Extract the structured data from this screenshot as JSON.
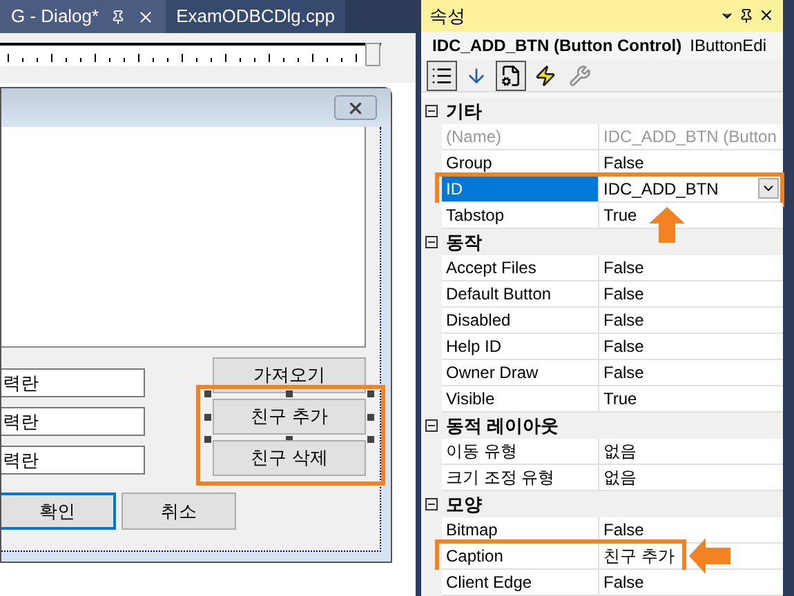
{
  "tabs": [
    {
      "label": "G - Dialog*",
      "selected": true
    },
    {
      "label": "ExamODBCDlg.cpp",
      "selected": false
    }
  ],
  "dialog": {
    "fields": [
      {
        "value": "력란"
      },
      {
        "value": "력란"
      },
      {
        "value": "력란"
      }
    ],
    "side_buttons": [
      {
        "label": "가져오기",
        "selected": false,
        "highlighted": false
      },
      {
        "label": "친구 추가",
        "selected": true,
        "highlighted": true
      },
      {
        "label": "친구 삭제",
        "selected": false,
        "highlighted": true
      }
    ],
    "bottom_buttons": [
      {
        "label": "확인",
        "default": true
      },
      {
        "label": "취소",
        "default": false
      }
    ]
  },
  "properties": {
    "title": "속성",
    "object": "IDC_ADD_BTN (Button Control)",
    "object_type": "IButtonEdi",
    "toolbar": [
      {
        "kind": "categorized",
        "selected": true
      },
      {
        "kind": "alphabetical",
        "selected": false
      },
      {
        "kind": "properties",
        "selected": true
      },
      {
        "kind": "events",
        "selected": false
      },
      {
        "kind": "pages",
        "selected": false,
        "disabled": true
      }
    ],
    "categories": [
      {
        "name": "기타",
        "expanded": true,
        "rows": [
          {
            "name": "(Name)",
            "value": "IDC_ADD_BTN (Button",
            "disabled": true,
            "selected": false
          },
          {
            "name": "Group",
            "value": "False",
            "disabled": false,
            "selected": false
          },
          {
            "name": "ID",
            "value": "IDC_ADD_BTN",
            "disabled": false,
            "selected": true,
            "highlighted": true,
            "annotation_arrow": {
              "kind": "up"
            }
          },
          {
            "name": "Tabstop",
            "value": "True",
            "disabled": false,
            "selected": false
          }
        ]
      },
      {
        "name": "동작",
        "expanded": true,
        "rows": [
          {
            "name": "Accept Files",
            "value": "False",
            "disabled": false,
            "selected": false
          },
          {
            "name": "Default Button",
            "value": "False",
            "disabled": false,
            "selected": false
          },
          {
            "name": "Disabled",
            "value": "False",
            "disabled": false,
            "selected": false
          },
          {
            "name": "Help ID",
            "value": "False",
            "disabled": false,
            "selected": false
          },
          {
            "name": "Owner Draw",
            "value": "False",
            "disabled": false,
            "selected": false
          },
          {
            "name": "Visible",
            "value": "True",
            "disabled": false,
            "selected": false
          }
        ]
      },
      {
        "name": "동적 레이아웃",
        "expanded": true,
        "rows": [
          {
            "name": "이동 유형",
            "value": "없음",
            "disabled": false,
            "selected": false
          },
          {
            "name": "크기 조정 유형",
            "value": "없음",
            "disabled": false,
            "selected": false
          }
        ]
      },
      {
        "name": "모양",
        "expanded": true,
        "rows": [
          {
            "name": "Bitmap",
            "value": "False",
            "disabled": false,
            "selected": false
          },
          {
            "name": "Caption",
            "value": "친구 추가",
            "disabled": false,
            "selected": false,
            "highlighted": true,
            "annotation_arrow": {
              "kind": "left"
            }
          },
          {
            "name": "Client Edge",
            "value": "False",
            "disabled": false,
            "selected": false
          }
        ]
      }
    ]
  }
}
